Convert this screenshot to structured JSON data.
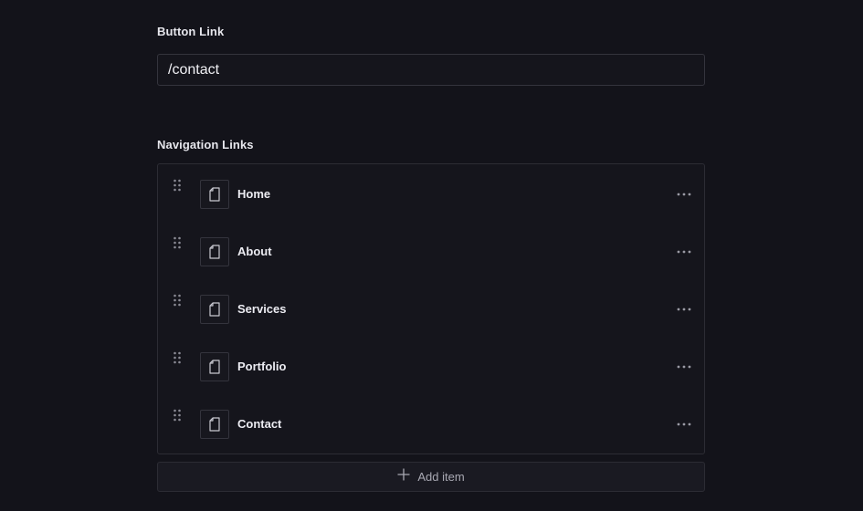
{
  "button_link": {
    "label": "Button Link",
    "value": "/contact"
  },
  "navigation": {
    "label": "Navigation Links",
    "items": [
      {
        "label": "Home",
        "icon": "document-icon"
      },
      {
        "label": "About",
        "icon": "document-icon"
      },
      {
        "label": "Services",
        "icon": "document-icon"
      },
      {
        "label": "Portfolio",
        "icon": "document-icon"
      },
      {
        "label": "Contact",
        "icon": "document-icon"
      }
    ],
    "add_label": "Add item"
  },
  "colors": {
    "background": "#13131a",
    "border": "#2c2c34",
    "text": "#e8e8ee",
    "muted": "#a8a8b2"
  }
}
